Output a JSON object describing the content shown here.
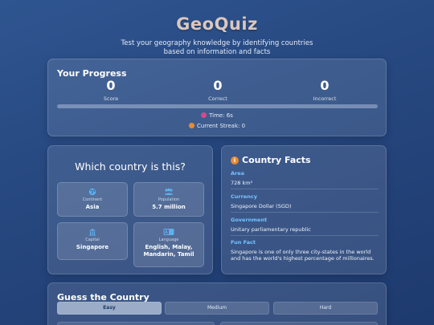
{
  "header": {
    "title": "GeoQuiz",
    "subtitle_line1": "Test your geography knowledge by identifying countries",
    "subtitle_line2": "based on information and facts"
  },
  "progress": {
    "title": "Your Progress",
    "stats": [
      {
        "value": "0",
        "label": "Score"
      },
      {
        "value": "0",
        "label": "Correct"
      },
      {
        "value": "0",
        "label": "Incorrect"
      }
    ],
    "progress_fraction": 0,
    "timer": "Time: 6s",
    "streak": "Current Streak: 0"
  },
  "question": {
    "title": "Which country is this?",
    "hints": [
      {
        "label": "Continent",
        "value": "Asia",
        "icon": "globe-icon"
      },
      {
        "label": "Population",
        "value": "5.7 million",
        "icon": "people-icon"
      },
      {
        "label": "Capital",
        "value": "Singapore",
        "icon": "landmark-icon"
      },
      {
        "label": "Language",
        "value": "English, Malay, Mandarin, Tamil",
        "icon": "language-icon"
      }
    ]
  },
  "facts": {
    "title": "Country Facts",
    "icon": "info-icon",
    "items": [
      {
        "label": "Area",
        "value": "728 km²"
      },
      {
        "label": "Currency",
        "value": "Singapore Dollar (SGD)"
      },
      {
        "label": "Government",
        "value": "Unitary parliamentary republic"
      },
      {
        "label": "Fun Fact",
        "value": "Singapore is one of only three city-states in the world and has the world's highest percentage of millionaires."
      }
    ]
  },
  "guess": {
    "title": "Guess the Country",
    "difficulties": [
      {
        "label": "Easy",
        "active": true
      },
      {
        "label": "Medium",
        "active": false
      },
      {
        "label": "Hard",
        "active": false
      }
    ]
  },
  "colors": {
    "accent_blue": "#75c3ff",
    "title_color": "#d9c7c0",
    "timer_dot": "#d24b8c",
    "streak_dot": "#e98a2f"
  }
}
